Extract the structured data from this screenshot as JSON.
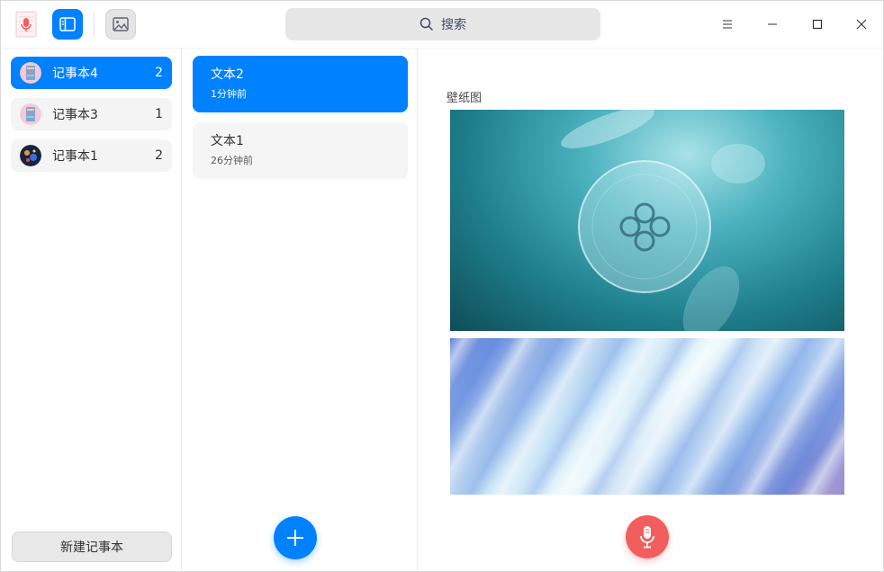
{
  "titlebar": {
    "search_label": "搜索",
    "icons": {
      "app": "voice-note-app-icon",
      "list_view": "sidebar-toggle-icon",
      "image": "image-icon",
      "search": "search-icon",
      "menu": "hamburger-menu-icon",
      "minimize": "minimize-icon",
      "maximize": "maximize-icon",
      "close": "close-icon"
    }
  },
  "sidebar": {
    "items": [
      {
        "name": "记事本4",
        "count": "2",
        "active": true
      },
      {
        "name": "记事本3",
        "count": "1",
        "active": false
      },
      {
        "name": "记事本1",
        "count": "2",
        "active": false
      }
    ],
    "new_notebook_label": "新建记事本"
  },
  "notelist": {
    "items": [
      {
        "title": "文本2",
        "time": "1分钟前",
        "active": true
      },
      {
        "title": "文本1",
        "time": "26分钟前",
        "active": false
      }
    ],
    "add_icon": "plus-icon"
  },
  "editor": {
    "label": "壁纸图",
    "images": [
      "jellyfish-wallpaper-image",
      "abstract-light-streaks-image"
    ],
    "record_icon": "microphone-icon"
  },
  "colors": {
    "accent": "#0081ff",
    "record": "#f25d5d",
    "window_bg": "#f8f8f8"
  }
}
